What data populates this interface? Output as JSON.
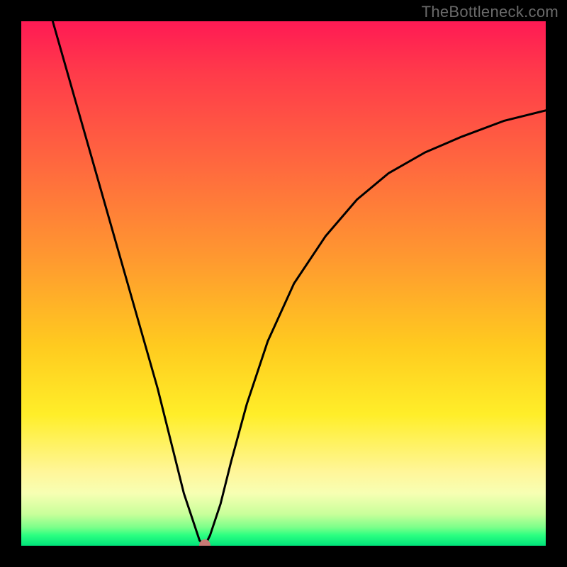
{
  "watermark": "TheBottleneck.com",
  "chart_data": {
    "type": "line",
    "title": "",
    "xlabel": "",
    "ylabel": "",
    "xlim": [
      0,
      100
    ],
    "ylim": [
      0,
      100
    ],
    "grid": false,
    "legend": false,
    "minimum_point": {
      "x": 35,
      "y": 0
    },
    "marker_color": "#c97a75",
    "series": [
      {
        "name": "left-branch",
        "x": [
          6,
          10,
          14,
          18,
          22,
          26,
          29,
          31,
          33,
          34,
          35
        ],
        "y": [
          100,
          86,
          72,
          58,
          44,
          30,
          18,
          10,
          4,
          1,
          0
        ]
      },
      {
        "name": "right-branch",
        "x": [
          35,
          36,
          38,
          40,
          43,
          47,
          52,
          58,
          64,
          70,
          77,
          84,
          92,
          100
        ],
        "y": [
          0,
          2,
          8,
          16,
          27,
          39,
          50,
          59,
          66,
          71,
          75,
          78,
          81,
          83
        ]
      }
    ],
    "gradient_stops": [
      {
        "pos": 0,
        "color": "#ff1a54"
      },
      {
        "pos": 0.1,
        "color": "#ff3b4a"
      },
      {
        "pos": 0.28,
        "color": "#ff6a3e"
      },
      {
        "pos": 0.45,
        "color": "#ff9830"
      },
      {
        "pos": 0.62,
        "color": "#ffcb1f"
      },
      {
        "pos": 0.75,
        "color": "#ffee29"
      },
      {
        "pos": 0.86,
        "color": "#fff69a"
      },
      {
        "pos": 0.9,
        "color": "#f7ffb3"
      },
      {
        "pos": 0.94,
        "color": "#c8ff9a"
      },
      {
        "pos": 0.965,
        "color": "#7bff8a"
      },
      {
        "pos": 0.98,
        "color": "#2cff81"
      },
      {
        "pos": 1.0,
        "color": "#00e37a"
      }
    ]
  }
}
